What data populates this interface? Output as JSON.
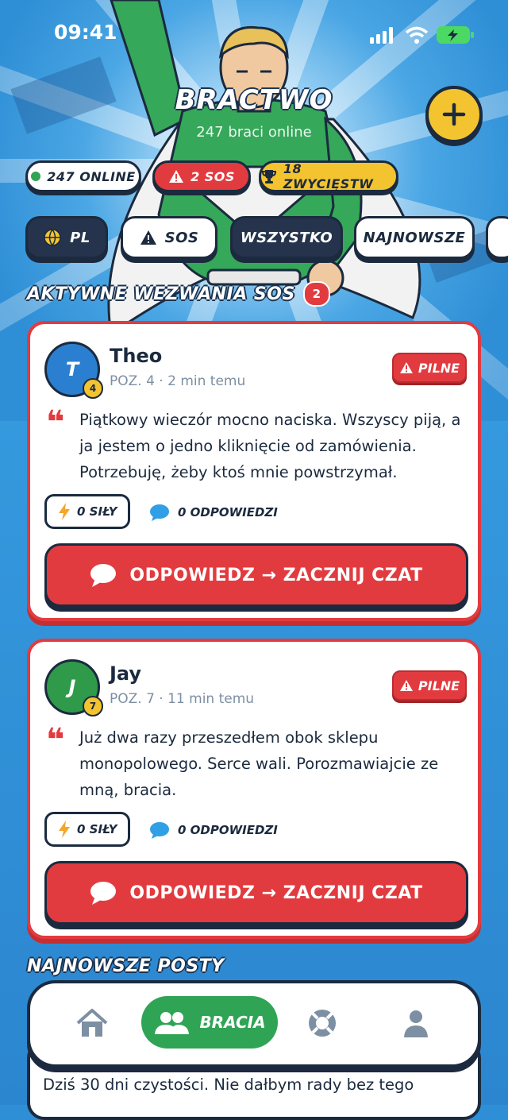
{
  "status_bar": {
    "time": "09:41"
  },
  "header": {
    "title": "BRACTWO",
    "subtitle": "247 braci online"
  },
  "stats": {
    "online": "247 ONLINE",
    "sos": "2 SOS",
    "wins": "18 ZWYCIĘSTW"
  },
  "filters": [
    {
      "label": "PL",
      "icon": "globe-icon"
    },
    {
      "label": "SOS",
      "icon": "warning-icon"
    },
    {
      "label": "WSZYSTKO"
    },
    {
      "label": "NAJNOWSZE"
    }
  ],
  "sos_section": {
    "title": "AKTYWNE WEZWANIA SOS",
    "count": "2"
  },
  "posts": [
    {
      "initial": "T",
      "level": "4",
      "name": "Theo",
      "meta": "POZ. 4 · 2 min temu",
      "badge": "PILNE",
      "text": "Piątkowy wieczór mocno naciska. Wszyscy piją, a ja jestem o jedno kliknięcie od zamówienia. Potrzebuję, żeby ktoś mnie powstrzymał.",
      "strength": "0 SIŁY",
      "replies": "0 ODPOWIEDZI",
      "reply_button": "ODPOWIEDZ → ZACZNIJ CZAT",
      "avatar_color": "#2b7fd0"
    },
    {
      "initial": "J",
      "level": "7",
      "name": "Jay",
      "meta": "POZ. 7 · 11 min temu",
      "badge": "PILNE",
      "text": "Już dwa razy przeszedłem obok sklepu monopolowego. Serce wali. Porozmawiajcie ze mną, bracia.",
      "strength": "0 SIŁY",
      "replies": "0 ODPOWIEDZI",
      "reply_button": "ODPOWIEDZ → ZACZNIJ CZAT",
      "avatar_color": "#2f9a4a"
    }
  ],
  "latest_section": {
    "title": "NAJNOWSZE POSTY"
  },
  "latest_post_preview": "Dziś 30 dni czystości. Nie dałbym rady bez tego",
  "tabbar": {
    "items": [
      {
        "icon": "home-icon"
      },
      {
        "icon": "users-icon",
        "label": "BRACIA",
        "active": true
      },
      {
        "icon": "lifebuoy-icon"
      },
      {
        "icon": "person-icon"
      }
    ]
  },
  "colors": {
    "accent_red": "#e23b3f",
    "accent_green": "#2fa455",
    "accent_yellow": "#f4c430",
    "ink": "#1b2a3e"
  }
}
